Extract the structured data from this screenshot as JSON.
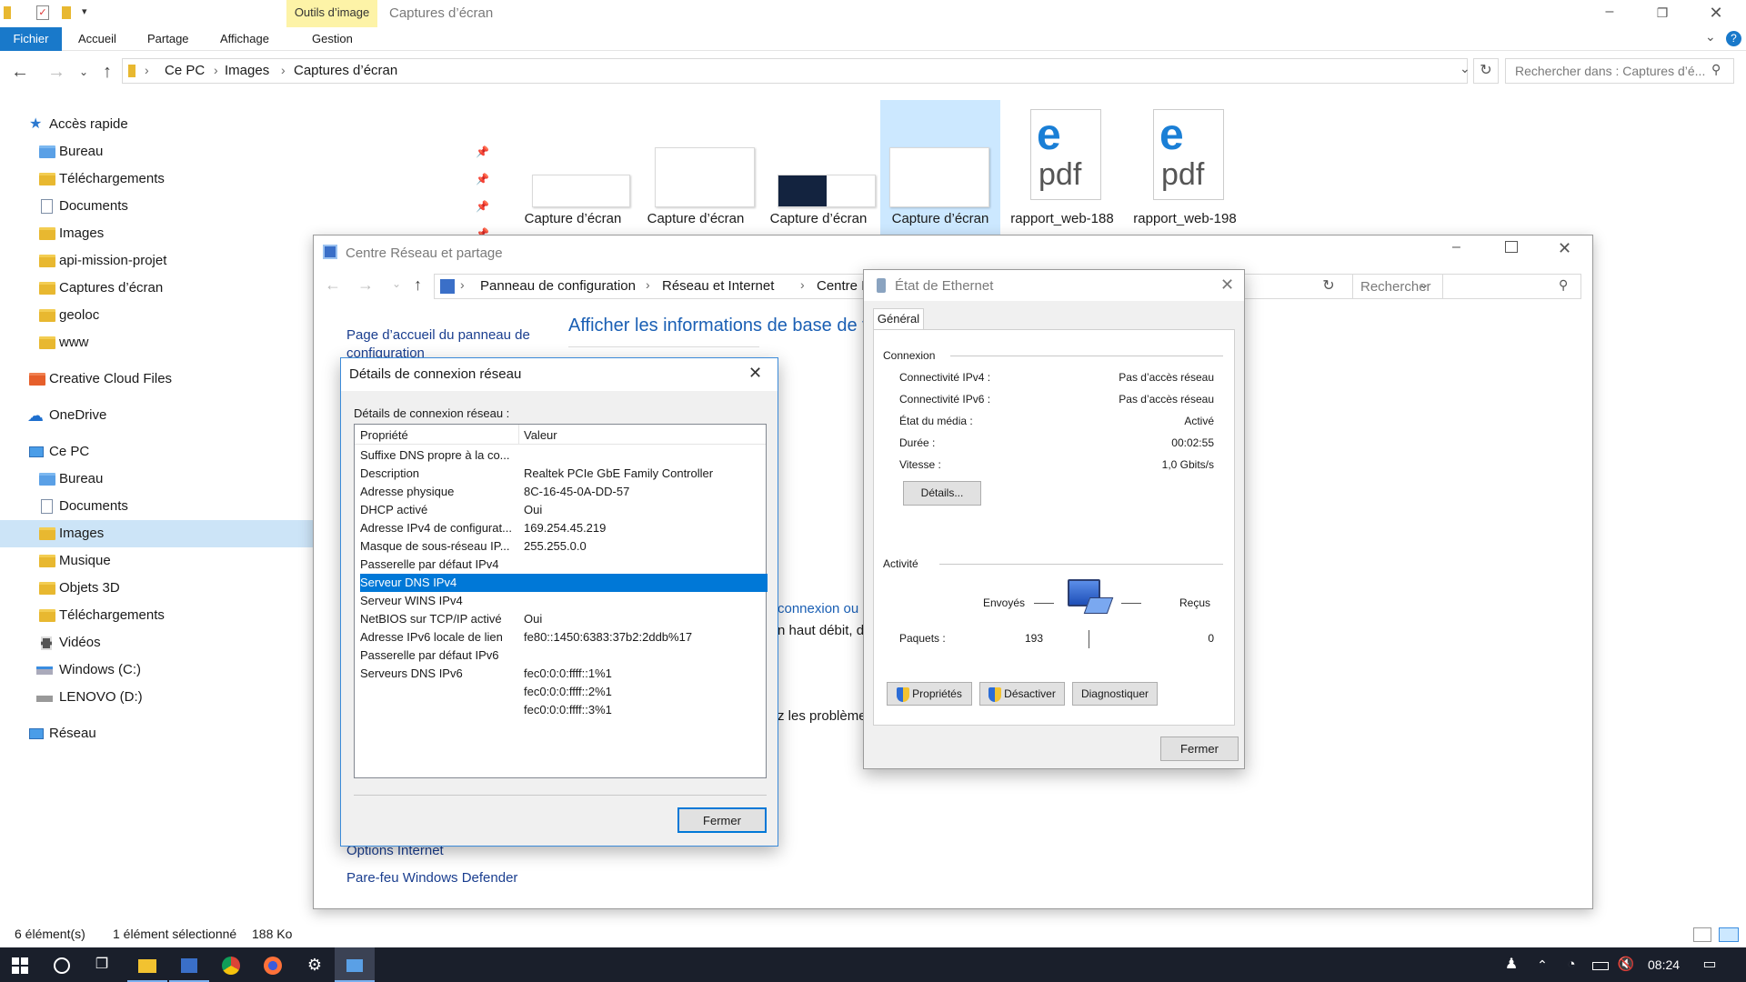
{
  "explorer": {
    "title": "Captures d’écran",
    "contextual_tab_group": "Outils d’image",
    "ribbon_tabs": [
      "Fichier",
      "Accueil",
      "Partage",
      "Affichage",
      "Gestion"
    ],
    "breadcrumb": [
      "Ce PC",
      "Images",
      "Captures d’écran"
    ],
    "search_placeholder": "Rechercher dans : Captures d’é...",
    "sidebar": {
      "quick_access": "Accès rapide",
      "quick_items": [
        "Bureau",
        "Téléchargements",
        "Documents",
        "Images",
        "api-mission-projet",
        "Captures d’écran",
        "geoloc",
        "www"
      ],
      "creative_cloud": "Creative Cloud Files",
      "onedrive": "OneDrive",
      "this_pc": "Ce PC",
      "pc_items": [
        "Bureau",
        "Documents",
        "Images",
        "Musique",
        "Objets 3D",
        "Téléchargements",
        "Vidéos",
        "Windows (C:)",
        "LENOVO (D:)"
      ],
      "network": "Réseau"
    },
    "files": [
      "Capture d’écran",
      "Capture d’écran",
      "Capture d’écran",
      "Capture d’écran",
      "rapport_web-188",
      "rapport_web-198"
    ],
    "pdf_label": "pdf",
    "status": {
      "count": "6 élément(s)",
      "selected": "1 élément sélectionné",
      "size": "188 Ko"
    }
  },
  "network_center": {
    "title": "Centre Réseau et partage",
    "breadcrumb": [
      "Panneau de configuration",
      "Réseau et Internet",
      "Centre Résea"
    ],
    "search_placeholder": "Rechercher",
    "left_link_home": "Page d’accueil du panneau de configuration",
    "heading": "Afficher les informations de base de v",
    "partial_link": "connexion ou u",
    "partial_text1": "n haut débit, d",
    "partial_text2": "z les problème",
    "bottom_links": [
      "Options Internet",
      "Pare-feu Windows Defender"
    ]
  },
  "details_dialog": {
    "title": "Détails de connexion réseau",
    "label": "Détails de connexion réseau :",
    "col_property": "Propriété",
    "col_value": "Valeur",
    "rows": [
      {
        "p": "Suffixe DNS propre à la co...",
        "v": ""
      },
      {
        "p": "Description",
        "v": "Realtek PCIe GbE Family Controller"
      },
      {
        "p": "Adresse physique",
        "v": "8C-16-45-0A-DD-57"
      },
      {
        "p": "DHCP activé",
        "v": "Oui"
      },
      {
        "p": "Adresse IPv4 de configurat...",
        "v": "169.254.45.219"
      },
      {
        "p": "Masque de sous-réseau IP...",
        "v": "255.255.0.0"
      },
      {
        "p": "Passerelle par défaut IPv4",
        "v": ""
      },
      {
        "p": "Serveur DNS IPv4",
        "v": ""
      },
      {
        "p": "Serveur WINS IPv4",
        "v": ""
      },
      {
        "p": "NetBIOS sur TCP/IP activé",
        "v": "Oui"
      },
      {
        "p": "Adresse IPv6 locale de lien",
        "v": "fe80::1450:6383:37b2:2ddb%17"
      },
      {
        "p": "Passerelle par défaut IPv6",
        "v": ""
      },
      {
        "p": "Serveurs DNS IPv6",
        "v": "fec0:0:0:ffff::1%1"
      },
      {
        "p": "",
        "v": "fec0:0:0:ffff::2%1"
      },
      {
        "p": "",
        "v": "fec0:0:0:ffff::3%1"
      }
    ],
    "close_button": "Fermer"
  },
  "ethernet_dialog": {
    "title": "État de Ethernet",
    "tab": "Général",
    "section_connection": "Connexion",
    "fields": [
      {
        "k": "Connectivité IPv4 :",
        "v": "Pas d’accès réseau"
      },
      {
        "k": "Connectivité IPv6 :",
        "v": "Pas d’accès réseau"
      },
      {
        "k": "État du média :",
        "v": "Activé"
      },
      {
        "k": "Durée :",
        "v": "00:02:55"
      },
      {
        "k": "Vitesse :",
        "v": "1,0 Gbits/s"
      }
    ],
    "details_button": "Détails...",
    "section_activity": "Activité",
    "sent_label": "Envoyés",
    "received_label": "Reçus",
    "packets_label": "Paquets :",
    "packets_sent": "193",
    "packets_received": "0",
    "properties_button": "Propriétés",
    "disable_button": "Désactiver",
    "diagnose_button": "Diagnostiquer",
    "close_button": "Fermer"
  },
  "taskbar": {
    "time": "08:24"
  }
}
